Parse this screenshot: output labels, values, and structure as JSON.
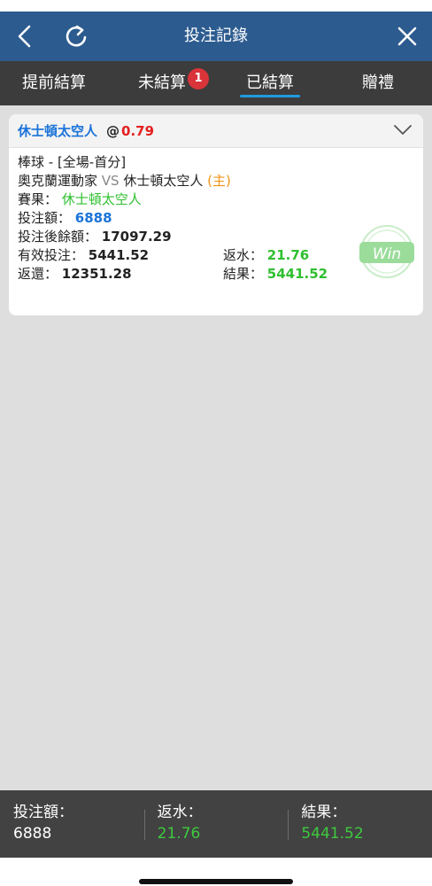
{
  "header": {
    "title": "投注記錄",
    "back_icon": "chevron-left-icon",
    "refresh_icon": "refresh-icon",
    "close_icon": "close-icon",
    "color": "#2c5b8f"
  },
  "tabs": [
    {
      "label": "提前結算",
      "active": false
    },
    {
      "label": "未結算",
      "active": false,
      "badge": "1"
    },
    {
      "label": "已結算",
      "active": true
    },
    {
      "label": "贈禮",
      "active": false
    }
  ],
  "bet": {
    "selection": "休士頓太空人",
    "at": "@",
    "odds": "0.79",
    "sport_market": "棒球 - [全場-首分]",
    "away_team": "奧克蘭運動家",
    "vs": "VS",
    "home_team": "休士頓太空人",
    "home_marker": "(主)",
    "result_label": "賽果：",
    "result_value": "休士頓太空人",
    "stake_label": "投注額：",
    "stake_value": "6888",
    "balance_label": "投注後餘額：",
    "balance_value": "17097.29",
    "valid_label": "有效投注：",
    "valid_value": "5441.52",
    "rebate_label": "返水：",
    "rebate_value": "21.76",
    "return_label": "返還：",
    "return_value": "12351.28",
    "outcome_label": "結果：",
    "outcome_value": "5441.52",
    "stamp": "Win"
  },
  "footer": {
    "stake_label": "投注額：",
    "stake_value": "6888",
    "rebate_label": "返水：",
    "rebate_value": "21.76",
    "result_label": "結果：",
    "result_value": "5441.52"
  },
  "colors": {
    "accent_blue": "#1a73d9",
    "win_green": "#2fbf2f",
    "odds_red": "#e32020",
    "home_orange": "#f29418",
    "tab_underline": "#1f9be0"
  }
}
